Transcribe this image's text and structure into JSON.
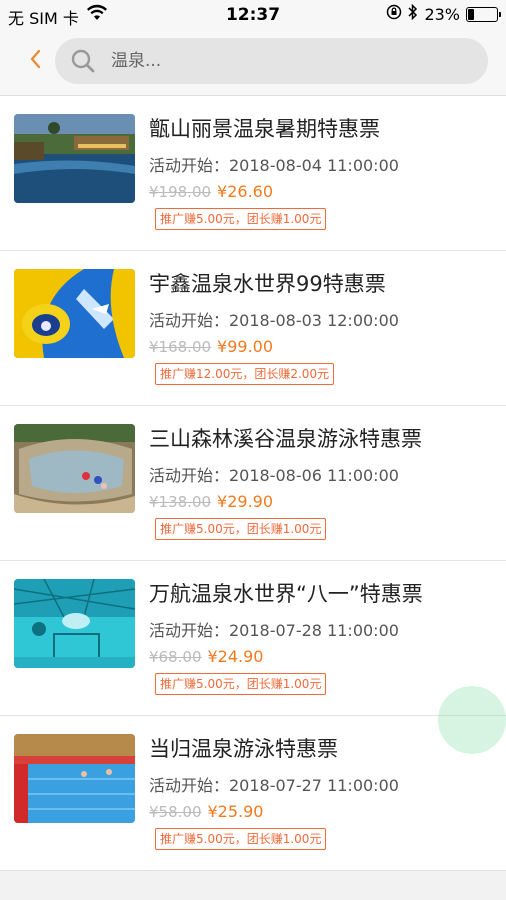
{
  "status_bar": {
    "carrier": "无 SIM 卡",
    "time": "12:37",
    "battery": "23%",
    "battery_level": 0.23
  },
  "nav": {
    "back_icon": "chevron-left-icon",
    "search_icon": "search-icon",
    "search_placeholder": "温泉..."
  },
  "colors": {
    "accent": "#f47a1f",
    "badge": "#f26a3a",
    "back": "#e9892b"
  },
  "items": [
    {
      "title": "甑山丽景温泉暑期特惠票",
      "start": "活动开始：2018-08-04 11:00:00",
      "old_price": "¥198.00",
      "new_price": "¥26.60",
      "badge": "推广赚5.00元，团长赚1.00元"
    },
    {
      "title": "宇鑫温泉水世界99特惠票",
      "start": "活动开始：2018-08-03 12:00:00",
      "old_price": "¥168.00",
      "new_price": "¥99.00",
      "badge": "推广赚12.00元，团长赚2.00元"
    },
    {
      "title": "三山森林溪谷温泉游泳特惠票",
      "start": "活动开始：2018-08-06 11:00:00",
      "old_price": "¥138.00",
      "new_price": "¥29.90",
      "badge": "推广赚5.00元，团长赚1.00元"
    },
    {
      "title": "万航温泉水世界“八一”特惠票",
      "start": "活动开始：2018-07-28 11:00:00",
      "old_price": "¥68.00",
      "new_price": "¥24.90",
      "badge": "推广赚5.00元，团长赚1.00元"
    },
    {
      "title": "当归温泉游泳特惠票",
      "start": "活动开始：2018-07-27 11:00:00",
      "old_price": "¥58.00",
      "new_price": "¥25.90",
      "badge": "推广赚5.00元，团长赚1.00元"
    }
  ]
}
